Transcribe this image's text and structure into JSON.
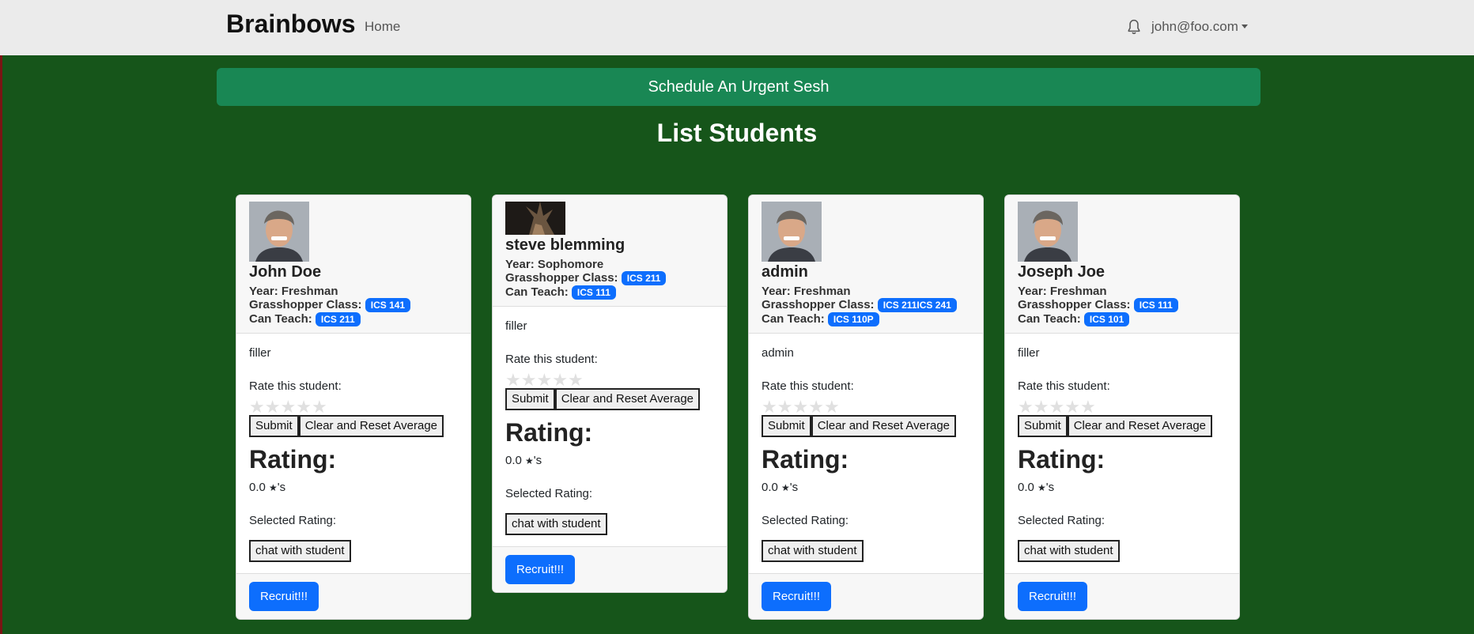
{
  "nav": {
    "brand": "Brainbows",
    "home": "Home",
    "user": "john@foo.com"
  },
  "urgent_button": "Schedule An Urgent Sesh",
  "page_title": "List Students",
  "labels": {
    "year": "Year:",
    "class": "Grasshopper Class:",
    "teach": "Can Teach:",
    "rate": "Rate this student:",
    "submit": "Submit",
    "clear": "Clear and Reset Average",
    "rating": "Rating:",
    "stars_suffix": "'s",
    "selected": "Selected Rating:",
    "chat": "chat with student",
    "recruit": "Recruit!!!"
  },
  "students": [
    {
      "name": "John Doe",
      "year": "Freshman",
      "classes": "ICS 141",
      "teaches": "ICS 211",
      "bio": "filler",
      "rating": "0.0"
    },
    {
      "name": "steve blemming",
      "year": "Sophomore",
      "classes": "ICS 211",
      "teaches": "ICS 111",
      "bio": "filler",
      "rating": "0.0"
    },
    {
      "name": "admin",
      "year": "Freshman",
      "classes": "ICS 211ICS 241",
      "teaches": "ICS 110P",
      "bio": "admin",
      "rating": "0.0"
    },
    {
      "name": "Joseph Joe",
      "year": "Freshman",
      "classes": "ICS 111",
      "teaches": "ICS 101",
      "bio": "filler",
      "rating": "0.0"
    }
  ],
  "colors": {
    "background": "#16551a",
    "urgent": "#198754",
    "primary": "#0d6efd"
  }
}
